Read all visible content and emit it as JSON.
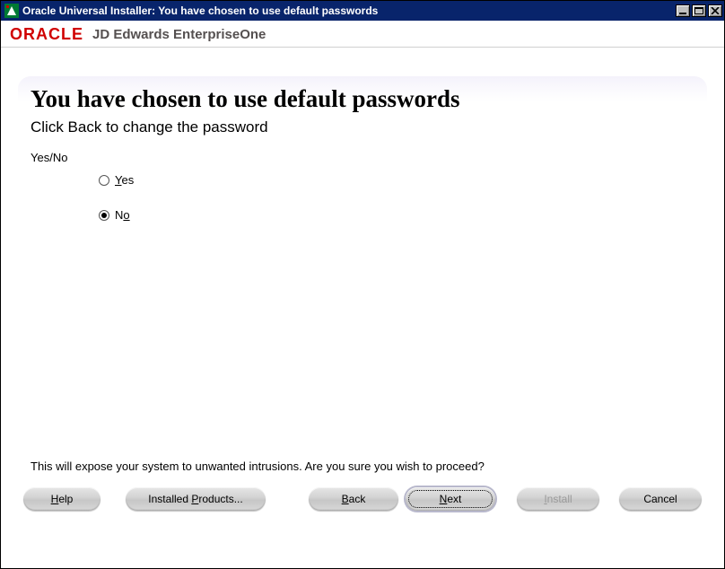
{
  "window": {
    "title": "Oracle Universal Installer: You have chosen to use default passwords"
  },
  "branding": {
    "logo_text": "ORACLE",
    "product": "JD Edwards EnterpriseOne"
  },
  "page": {
    "title": "You have chosen to use default passwords",
    "subtitle": "Click  Back to change the password",
    "group_label": "Yes/No",
    "options": {
      "yes_prefix": "Y",
      "yes_rest": "es",
      "no_prefix": "N",
      "no_underlined": "o",
      "selected": "no"
    },
    "warning": "This will expose your system to unwanted intrusions.  Are you sure you wish to proceed?"
  },
  "buttons": {
    "help": "Help",
    "installed": "Installed Products...",
    "back": "Back",
    "next": "Next",
    "install": "Install",
    "cancel": "Cancel"
  }
}
